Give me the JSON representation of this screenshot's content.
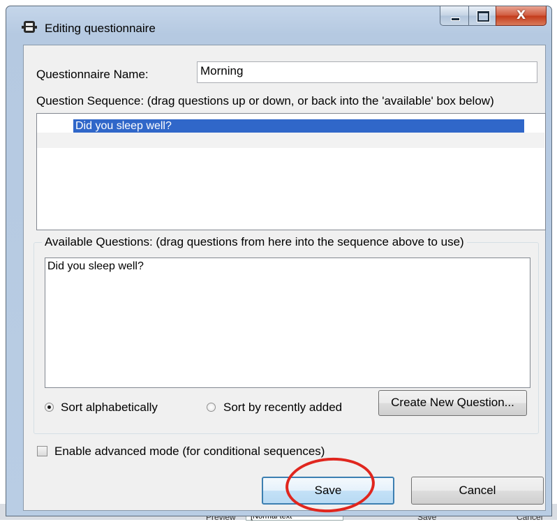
{
  "window": {
    "title": "Editing questionnaire",
    "close_glyph": "X"
  },
  "form": {
    "name_label": "Questionnaire Name:",
    "name_value": "Morning",
    "sequence_label": "Question Sequence: (drag questions up or down, or back into the 'available' box below)",
    "sequence_items": [
      "Did you sleep well?"
    ],
    "available_legend": "Available Questions: (drag questions from here into the sequence above to use)",
    "available_items": [
      "Did you sleep well?"
    ],
    "sort_alpha_label": "Sort alphabetically",
    "sort_alpha_checked": true,
    "sort_recent_label": "Sort by recently added",
    "sort_recent_checked": false,
    "create_button": "Create New Question...",
    "advanced_label": "Enable advanced mode (for conditional sequences)",
    "advanced_checked": false
  },
  "actions": {
    "save": "Save",
    "cancel": "Cancel"
  },
  "background_app": {
    "item1": "Preview",
    "combo": "[Normal text",
    "save": "Save",
    "cancel": "Cancel"
  },
  "colors": {
    "selection": "#3067c9",
    "annotation": "#e0261e"
  }
}
